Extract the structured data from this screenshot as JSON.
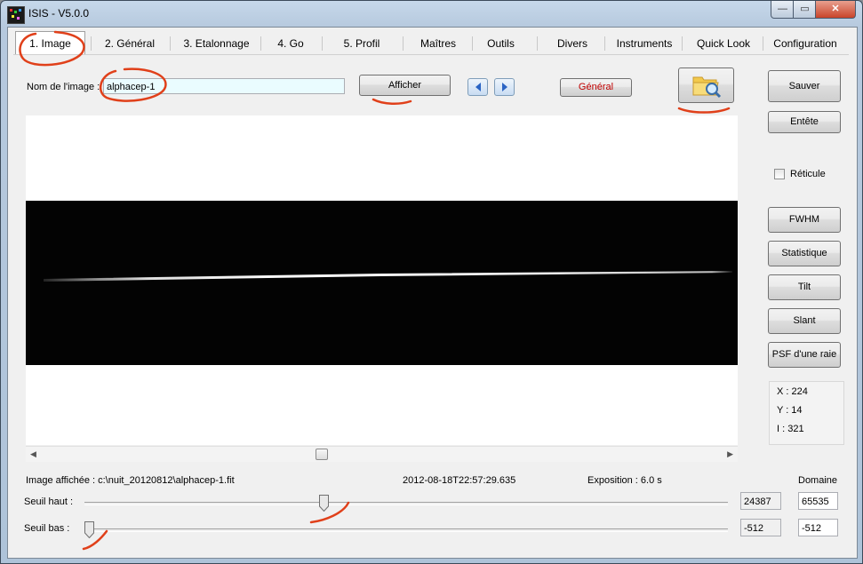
{
  "window": {
    "title": "ISIS - V5.0.0",
    "min_glyph": "—",
    "max_glyph": "▭",
    "close_glyph": "✕"
  },
  "tabs": [
    {
      "label": "1. Image"
    },
    {
      "label": "2. Général"
    },
    {
      "label": "3. Etalonnage"
    },
    {
      "label": "4. Go"
    },
    {
      "label": "5. Profil"
    },
    {
      "label": "Maîtres"
    },
    {
      "label": "Outils"
    },
    {
      "label": "Divers"
    },
    {
      "label": "Instruments"
    },
    {
      "label": "Quick Look"
    },
    {
      "label": "Configuration"
    }
  ],
  "image_name": {
    "label": "Nom de l'image :",
    "value": "alphacep-1"
  },
  "buttons": {
    "afficher": "Afficher",
    "general": "Général",
    "sauver": "Sauver",
    "entete": "Entête",
    "fwhm": "FWHM",
    "statistique": "Statistique",
    "tilt": "Tilt",
    "slant": "Slant",
    "psf": "PSF d'une raie"
  },
  "reticule": {
    "label": "Réticule",
    "checked": false
  },
  "coords": {
    "x": "X : 224",
    "y": "Y : 14",
    "i": "I  : 321"
  },
  "status": {
    "image_affichee": "Image affichée : c:\\nuit_20120812\\alphacep-1.fit",
    "datetime": "2012-08-18T22:57:29.635",
    "exposition": "Exposition : 6.0 s",
    "domaine_label": "Domaine"
  },
  "seuil_haut": {
    "label": "Seuil haut :",
    "value": "24387",
    "domaine": "65535",
    "level": 0.37
  },
  "seuil_bas": {
    "label": "Seuil bas :",
    "value": "-512",
    "domaine": "-512",
    "level": 0.0
  },
  "colors": {
    "annotation": "#e0401a",
    "close": "#c9442a",
    "tab_line": "#d0d0d0"
  }
}
